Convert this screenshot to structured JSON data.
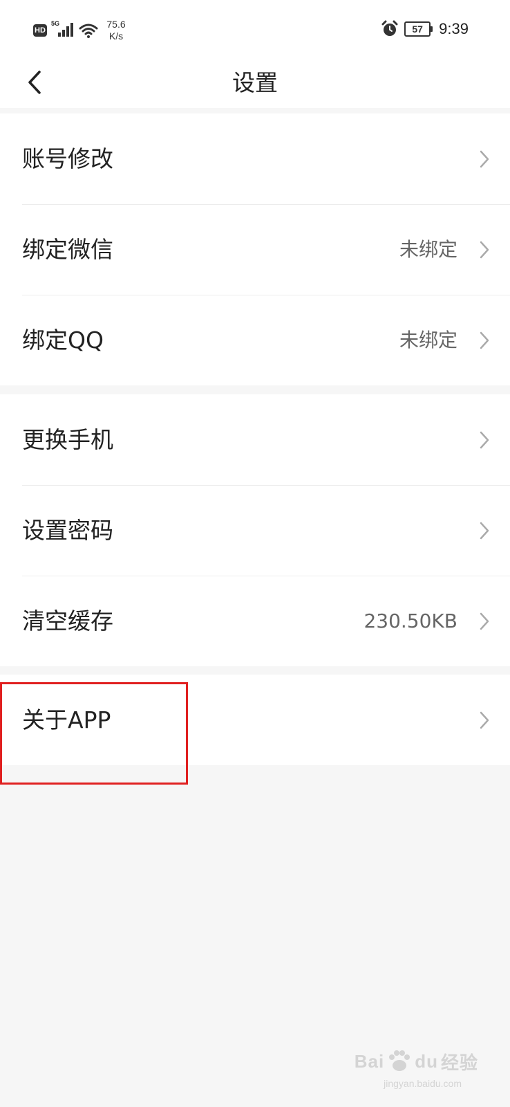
{
  "status_bar": {
    "hd": "HD",
    "network": "5G",
    "speed_value": "75.6",
    "speed_unit": "K/s",
    "battery": "57",
    "time": "9:39"
  },
  "nav": {
    "title": "设置"
  },
  "groups": [
    {
      "rows": [
        {
          "label": "账号修改",
          "value": ""
        },
        {
          "label": "绑定微信",
          "value": "未绑定"
        },
        {
          "label": "绑定QQ",
          "value": "未绑定"
        }
      ]
    },
    {
      "rows": [
        {
          "label": "更换手机",
          "value": ""
        },
        {
          "label": "设置密码",
          "value": ""
        },
        {
          "label": "清空缓存",
          "value": "230.50KB"
        }
      ]
    },
    {
      "rows": [
        {
          "label": "关于APP",
          "value": ""
        }
      ]
    }
  ],
  "watermark": {
    "brand_left": "Bai",
    "brand_right": "du",
    "brand_cn": "经验",
    "url": "jingyan.baidu.com"
  },
  "colors": {
    "highlight": "#e02020",
    "background": "#f6f6f6"
  }
}
